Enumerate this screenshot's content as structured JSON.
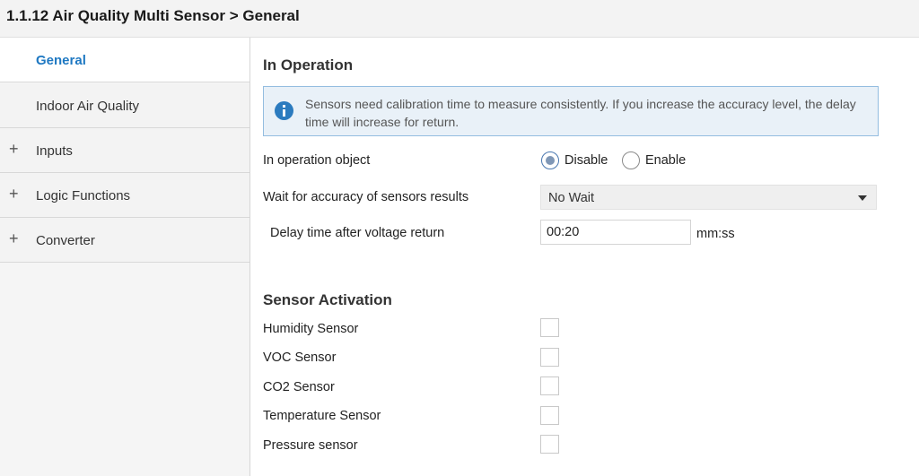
{
  "header": {
    "title": "1.1.12 Air Quality Multi Sensor > General"
  },
  "sidebar": {
    "items": [
      {
        "label": "General",
        "active": true,
        "expandable": false
      },
      {
        "label": "Indoor Air Quality",
        "active": false,
        "expandable": false
      },
      {
        "label": "Inputs",
        "active": false,
        "expandable": true
      },
      {
        "label": "Logic Functions",
        "active": false,
        "expandable": true
      },
      {
        "label": "Converter",
        "active": false,
        "expandable": true
      }
    ],
    "plus_glyph": "+"
  },
  "main": {
    "in_operation": {
      "title": "In Operation",
      "info_text": "Sensors need calibration time to measure consistently. If you increase the accuracy level, the delay time will increase for return.",
      "info_icon": "info-icon",
      "operation_object": {
        "label": "In operation object",
        "options": [
          "Disable",
          "Enable"
        ],
        "selected": "Disable"
      },
      "wait_accuracy": {
        "label": "Wait for accuracy of sensors results",
        "value": "No Wait"
      },
      "delay_time": {
        "label": "Delay time after voltage return",
        "value": "00:20",
        "unit": "mm:ss"
      }
    },
    "sensor_activation": {
      "title": "Sensor Activation",
      "sensors": [
        {
          "label": "Humidity Sensor",
          "checked": false
        },
        {
          "label": "VOC Sensor",
          "checked": false
        },
        {
          "label": "CO2 Sensor",
          "checked": false
        },
        {
          "label": "Temperature Sensor",
          "checked": false
        },
        {
          "label": "Pressure sensor",
          "checked": false
        }
      ]
    }
  },
  "colors": {
    "accent": "#1e78c2",
    "info_background": "#e9f1f8",
    "info_border": "#94bde0",
    "info_icon": "#2b7bbf"
  }
}
